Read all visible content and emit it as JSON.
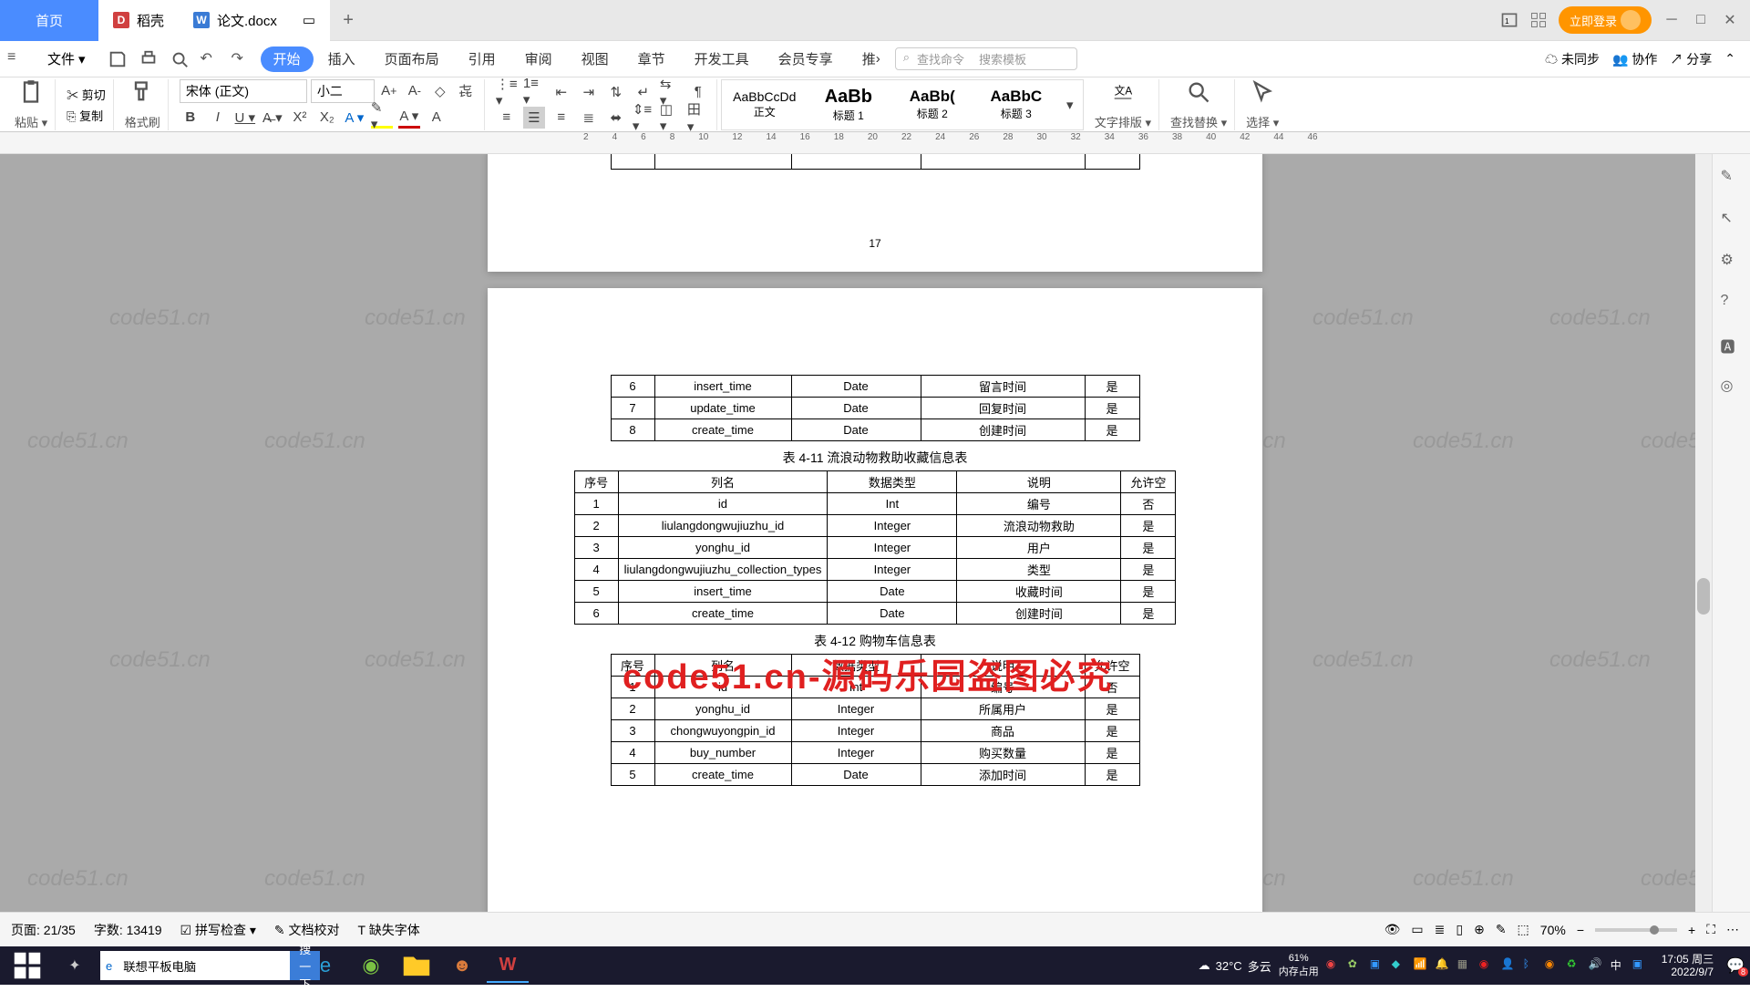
{
  "titlebar": {
    "tab_home": "首页",
    "tab_shell": "稻壳",
    "tab_doc": "论文.docx",
    "login": "立即登录"
  },
  "menubar": {
    "file": "文件",
    "items": [
      "开始",
      "插入",
      "页面布局",
      "引用",
      "审阅",
      "视图",
      "章节",
      "开发工具",
      "会员专享",
      "推"
    ],
    "search_cmd": "查找命令",
    "search_tpl": "搜索模板",
    "unsync": "未同步",
    "collab": "协作",
    "share": "分享"
  },
  "ribbon": {
    "paste": "粘贴",
    "cut": "剪切",
    "copy": "复制",
    "fmt_painter": "格式刷",
    "font_name": "宋体 (正文)",
    "font_size": "小二",
    "styles": [
      {
        "preview": "AaBbCcDd",
        "label": "正文",
        "cls": ""
      },
      {
        "preview": "AaBb",
        "label": "标题 1",
        "cls": "big"
      },
      {
        "preview": "AaBb(",
        "label": "标题 2",
        "cls": "med"
      },
      {
        "preview": "AaBbC",
        "label": "标题 3",
        "cls": "med"
      }
    ],
    "text_layout": "文字排版",
    "find_replace": "查找替换",
    "select": "选择"
  },
  "ruler_marks": [
    "2",
    "4",
    "6",
    "8",
    "10",
    "12",
    "14",
    "16",
    "18",
    "20",
    "22",
    "24",
    "26",
    "28",
    "30",
    "32",
    "34",
    "36",
    "38",
    "40",
    "42",
    "44",
    "46"
  ],
  "doc": {
    "page_num_17": "17",
    "watermark_text": "code51.cn",
    "big_watermark": "code51.cn-源码乐园盗图必究",
    "zoom_center": "61%\n内存占用",
    "table_top": {
      "rows": [
        [
          "6",
          "insert_time",
          "Date",
          "留言时间",
          "是"
        ],
        [
          "7",
          "update_time",
          "Date",
          "回复时间",
          "是"
        ],
        [
          "8",
          "create_time",
          "Date",
          "创建时间",
          "是"
        ]
      ]
    },
    "table11_caption": "表 4-11 流浪动物救助收藏信息表",
    "table11": {
      "header": [
        "序号",
        "列名",
        "数据类型",
        "说明",
        "允许空"
      ],
      "rows": [
        [
          "1",
          "id",
          "Int",
          "编号",
          "否"
        ],
        [
          "2",
          "liulangdongwujiuzhu_id",
          "Integer",
          "流浪动物救助",
          "是"
        ],
        [
          "3",
          "yonghu_id",
          "Integer",
          "用户",
          "是"
        ],
        [
          "4",
          "liulangdongwujiuzhu_collection_types",
          "Integer",
          "类型",
          "是"
        ],
        [
          "5",
          "insert_time",
          "Date",
          "收藏时间",
          "是"
        ],
        [
          "6",
          "create_time",
          "Date",
          "创建时间",
          "是"
        ]
      ]
    },
    "table12_caption": "表 4-12 购物车信息表",
    "table12": {
      "header": [
        "序号",
        "列名",
        "数据类型",
        "说明",
        "允许空"
      ],
      "rows": [
        [
          "1",
          "id",
          "Int",
          "编号",
          "否"
        ],
        [
          "2",
          "yonghu_id",
          "Integer",
          "所属用户",
          "是"
        ],
        [
          "3",
          "chongwuyongpin_id",
          "Integer",
          "商品",
          "是"
        ],
        [
          "4",
          "buy_number",
          "Integer",
          "购买数量",
          "是"
        ],
        [
          "5",
          "create_time",
          "Date",
          "添加时间",
          "是"
        ]
      ]
    }
  },
  "statusbar": {
    "page": "页面: 21/35",
    "words": "字数: 13419",
    "spell": "拼写检查",
    "proof": "文档校对",
    "missing_font": "缺失字体",
    "zoom": "70%"
  },
  "taskbar": {
    "search_placeholder": "联想平板电脑",
    "search_go": "搜一下",
    "weather_temp": "32°C",
    "weather_text": "多云",
    "ime": "中",
    "time": "17:05 周三",
    "date": "2022/9/7",
    "notif": "8"
  }
}
